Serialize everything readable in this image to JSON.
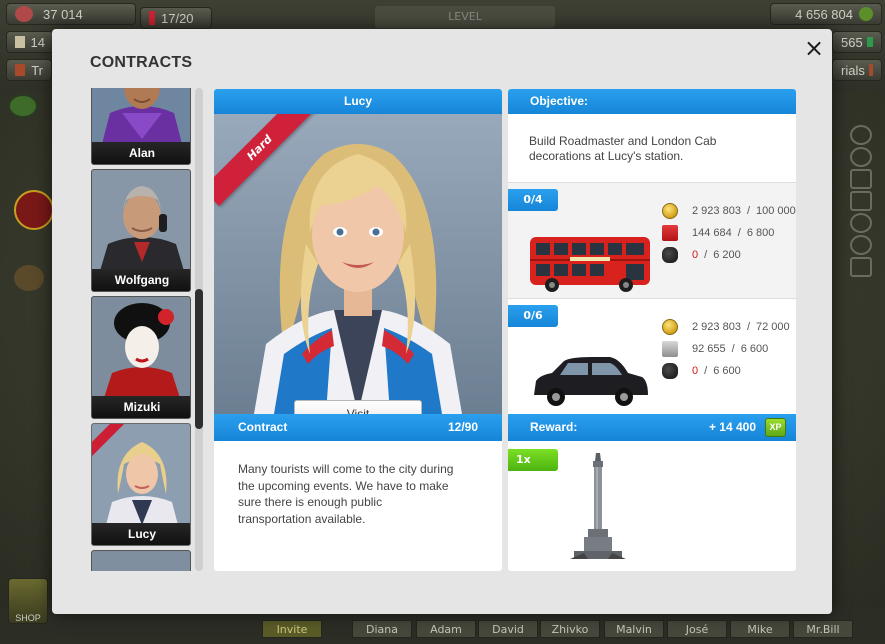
{
  "hud": {
    "population": "37 014",
    "trains": "17/20",
    "level_label": "LEVEL",
    "mail_count": "14",
    "coins": "4 656 804",
    "gems": "565",
    "train_label": "Tr",
    "materials_label": "rials"
  },
  "friends": [
    "Invite",
    "Diana",
    "Adam",
    "David",
    "Zhivko",
    "Malvin",
    "José",
    "Mike",
    "Mr.Bill"
  ],
  "shop_label": "SHOP",
  "modal": {
    "title": "CONTRACTS",
    "close_label": "×",
    "characters": [
      {
        "name": "Alan",
        "shirt": "#6a2fa0",
        "skin": "#b07a55",
        "hair": "#3a2a1e"
      },
      {
        "name": "Wolfgang",
        "shirt": "#2a2a2e",
        "skin": "#c79a7a",
        "hair": "#b7b2ac"
      },
      {
        "name": "Mizuki",
        "shirt": "#b51a1a",
        "skin": "#f4efe8",
        "hair": "#101010"
      },
      {
        "name": "Lucy",
        "shirt": "#e8e8ee",
        "skin": "#efc6a8",
        "hair": "#e9cf8c"
      }
    ],
    "selected": {
      "name": "Lucy",
      "difficulty": "Hard",
      "visit_label": "Visit",
      "contract_label": "Contract",
      "contract_progress": "12/90",
      "description": "Many tourists will come to the city during the upcoming events. We have to make sure there is enough public transportation available."
    },
    "objective": {
      "header": "Objective:",
      "text": "Build Roadmaster and London Cab decorations at Lucy's station.",
      "tasks": [
        {
          "progress": "0/4",
          "item": "Roadmaster bus",
          "requirements": [
            {
              "icon": "coin-icon",
              "have": "2 923 803",
              "need": "100 000",
              "short": false
            },
            {
              "icon": "fuel-icon",
              "have": "144 684",
              "need": "6 800",
              "short": false
            },
            {
              "icon": "coal-icon",
              "have": "0",
              "need": "6 200",
              "short": true
            }
          ]
        },
        {
          "progress": "0/6",
          "item": "London Cab",
          "requirements": [
            {
              "icon": "coin-icon",
              "have": "2 923 803",
              "need": "72 000",
              "short": false
            },
            {
              "icon": "steel-icon",
              "have": "92 655",
              "need": "6 600",
              "short": false
            },
            {
              "icon": "coal-icon",
              "have": "0",
              "need": "6 600",
              "short": true
            }
          ]
        }
      ],
      "reward_label": "Reward:",
      "reward_value": "+ 14 400",
      "xp_label": "XP",
      "reward_item_qty": "1x",
      "reward_item": "Nelson's Column monument"
    }
  },
  "colors": {
    "accent_blue": "#1e93e4",
    "ribbon_red": "#d0213a",
    "green": "#5ab51a",
    "shortage_red": "#d01818"
  }
}
